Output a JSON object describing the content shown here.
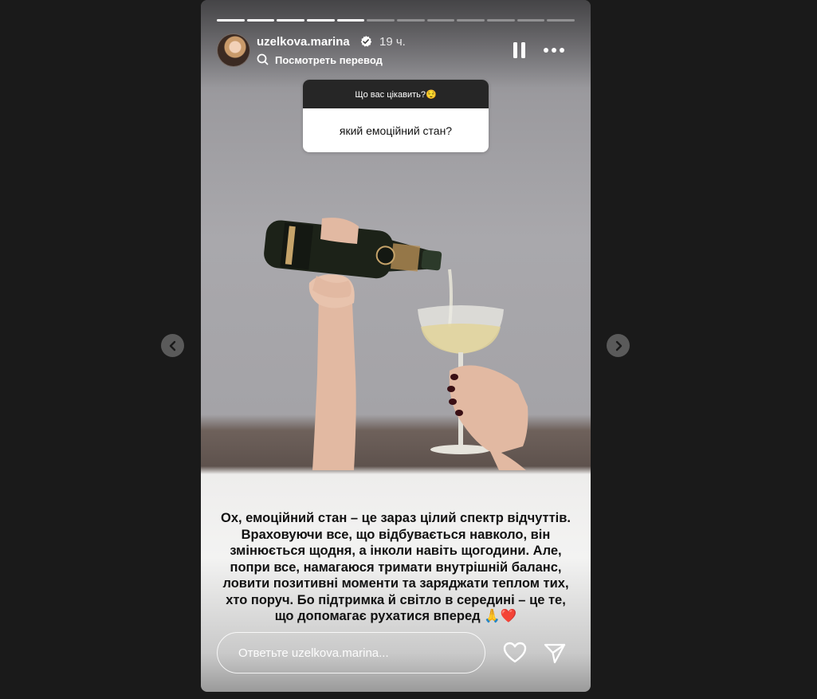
{
  "story": {
    "progress": {
      "total": 12,
      "completed": 4,
      "current": 5
    },
    "username": "uzelkova.marina",
    "time_ago": "19 ч.",
    "translate_label": "Посмотреть перевод",
    "question_sticker": {
      "prompt": "Що вас цікавить?😌",
      "answer": "який емоційний стан?"
    },
    "caption": "Ох, емоційний стан – це зараз цілий спектр відчуттів. Враховуючи все, що відбувається навколо, він змінюється щодня, а інколи навіть щогодини. Але, попри все, намагаюся тримати внутрішній баланс, ловити позитивні моменти та заряджати теплом тих, хто поруч. Бо підтримка й світло в середині – це те, що допомагає рухатися вперед 🙏❤️",
    "reply_placeholder": "Ответьте uzelkova.marina..."
  },
  "icons": {
    "verified": "verified-badge-icon",
    "translate": "translate-icon",
    "pause": "pause-icon",
    "more": "more-options-icon",
    "heart": "heart-icon",
    "send": "send-icon",
    "prev": "chevron-left-icon",
    "next": "chevron-right-icon"
  },
  "colors": {
    "background": "#1a1a1a",
    "sticker_header": "#262626",
    "nav_button": "#5a5a5a"
  }
}
